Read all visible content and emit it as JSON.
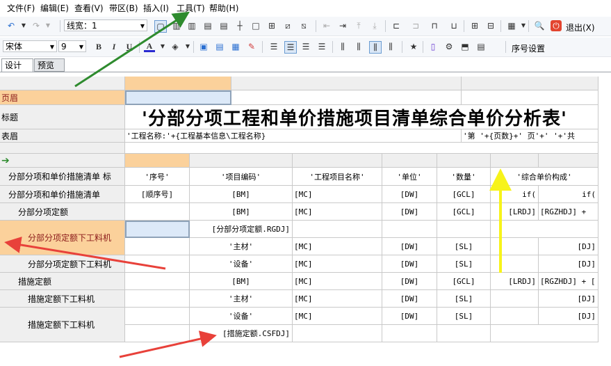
{
  "menu": [
    "文件(F)",
    "编辑(E)",
    "查看(V)",
    "带区(B)",
    "插入(I)",
    "工具(T)",
    "帮助(H)"
  ],
  "toolbar1": {
    "line_width_label": "线宽：1",
    "exit_label": "退出(X)"
  },
  "toolbar2": {
    "font_name": "宋体",
    "font_size": "9",
    "bold": "B",
    "italic": "I",
    "underline": "U",
    "font_color": "A",
    "seq_settings": "序号设置"
  },
  "tabs": {
    "design": "设计",
    "preview": "预览"
  },
  "bands": {
    "page_header": "页眉",
    "title": "标题",
    "table_header": "表眉",
    "row_a": "分部分项和单价措施清单 标",
    "row_b": "分部分项和单价措施清单",
    "row_c": "分部分项定额",
    "row_d": "分部分项定额下工料机",
    "row_e": "分部分项定额下工料机",
    "row_f": "措施定额",
    "row_g": "措施定额下工料机",
    "row_h": "措施定额下工料机"
  },
  "title_text": "'分部分项工程和单价措施项目清单综合单价分析表'",
  "table_header_left": "'工程名称:'+{工程基本信息\\工程名称}",
  "table_header_right": "'第 '+{页数}+' 页'+'  '+'共",
  "col_headers": [
    "'序号'",
    "'项目编码'",
    "'工程项目名称'",
    "'单位'",
    "'数量'",
    "'综合单价构成'"
  ],
  "rows": {
    "r1": [
      "[顺序号]",
      "[BM]",
      "[MC]",
      "[DW]",
      "[GCL]",
      "if(",
      "if("
    ],
    "r2": [
      "",
      "[BM]",
      "[MC]",
      "[DW]",
      "[GCL]",
      "[LRDJ]",
      "[RGZHDJ] +"
    ],
    "r3": [
      "[分部分项定额.RGDJ]"
    ],
    "r4": [
      "'主材'",
      "[MC]",
      "[DW]",
      "[SL]",
      "[DJ]"
    ],
    "r5": [
      "'设备'",
      "[MC]",
      "[DW]",
      "[SL]",
      "[DJ]"
    ],
    "r6": [
      "[BM]",
      "[MC]",
      "[DW]",
      "[GCL]",
      "[LRDJ]",
      "[RGZHDJ] + ["
    ],
    "r7": [
      "'主材'",
      "[MC]",
      "[DW]",
      "[SL]",
      "[DJ]"
    ],
    "r8": [
      "'设备'",
      "[MC]",
      "[DW]",
      "[SL]",
      "[DJ]"
    ],
    "r9": [
      "[措施定额.CSFDJ]"
    ]
  },
  "icons": {
    "undo": "undo-icon",
    "redo": "redo-icon",
    "bold": "bold-icon",
    "exit": "exit-icon",
    "arrow_marker": "green-arrow-icon"
  },
  "colors": {
    "band_orange": "#fbd19b",
    "green_arrow": "#2e8b2e",
    "red_arrow": "#e8413a",
    "yellow_arrow": "#f7f31a",
    "selected_blue": "#dce9f8"
  }
}
